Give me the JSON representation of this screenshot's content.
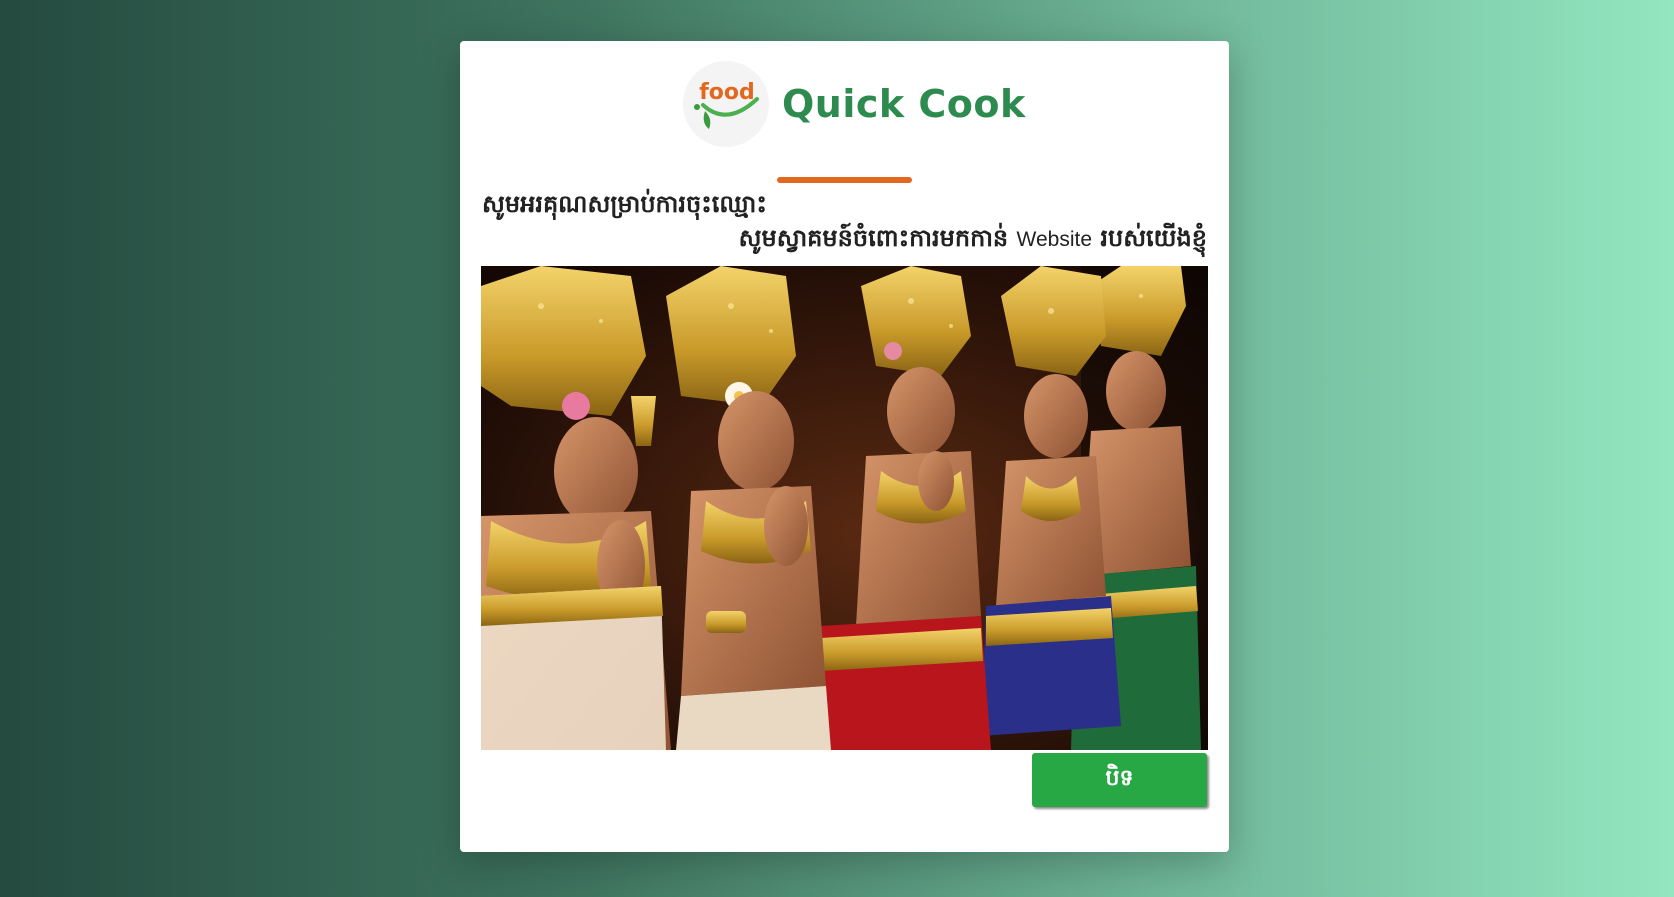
{
  "brand": {
    "logo_text": "food",
    "name": "Quick Cook"
  },
  "message": {
    "line1": "សូមអរគុណសម្រាប់ការចុះឈ្មោះ",
    "line2_before": "សូមស្វាគមន៍ចំពោះការមកកាន់ ",
    "line2_latin": "Website",
    "line2_after": " របស់យើងខ្ញុំ"
  },
  "image": {
    "subject": "Apsara dancers"
  },
  "actions": {
    "close_label": "បិទ"
  },
  "colors": {
    "brand_green": "#2e8b4f",
    "accent_orange": "#e2681f",
    "button_green": "#28a745"
  }
}
